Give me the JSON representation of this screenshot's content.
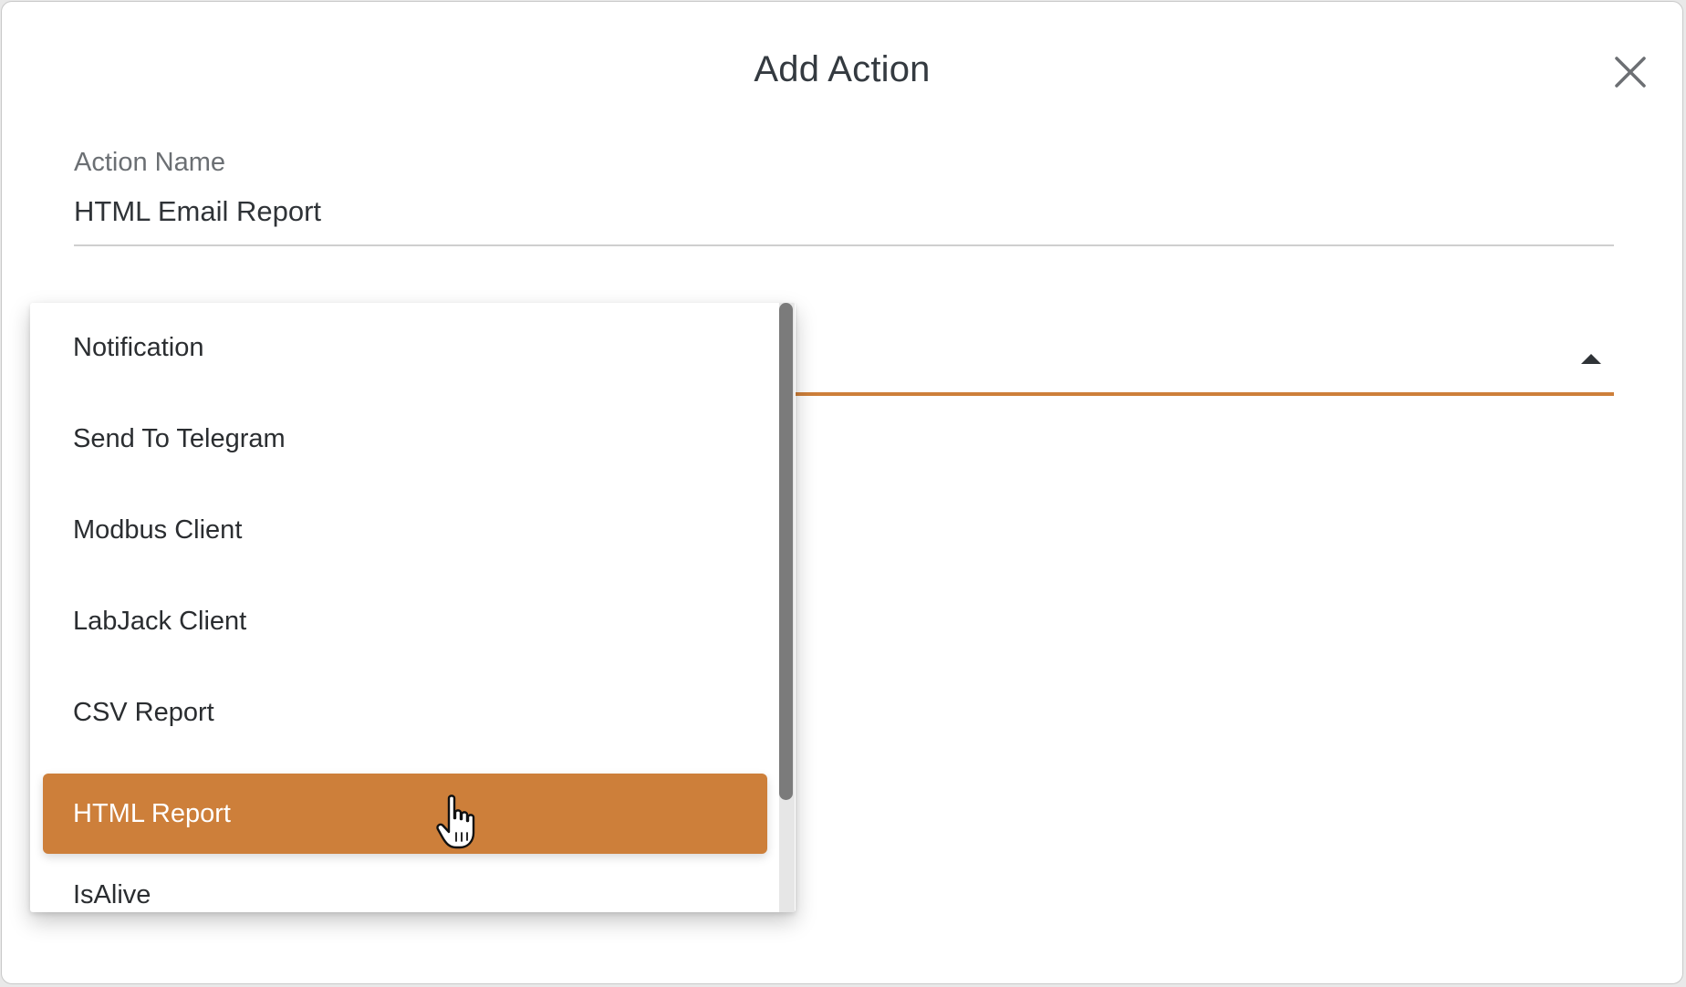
{
  "dialog": {
    "title": "Add Action",
    "close_icon": "close-icon"
  },
  "action_name": {
    "label": "Action Name",
    "value": "HTML Email Report"
  },
  "action_type": {
    "arrow_icon": "caret-up-icon",
    "accent_color": "#cd7f3a",
    "options": [
      "Notification",
      "Send To Telegram",
      "Modbus Client",
      "LabJack Client",
      "CSV Report",
      "HTML Report",
      "IsAlive"
    ],
    "highlighted": "HTML Report"
  },
  "cursor": {
    "icon": "hand-pointer-icon"
  }
}
